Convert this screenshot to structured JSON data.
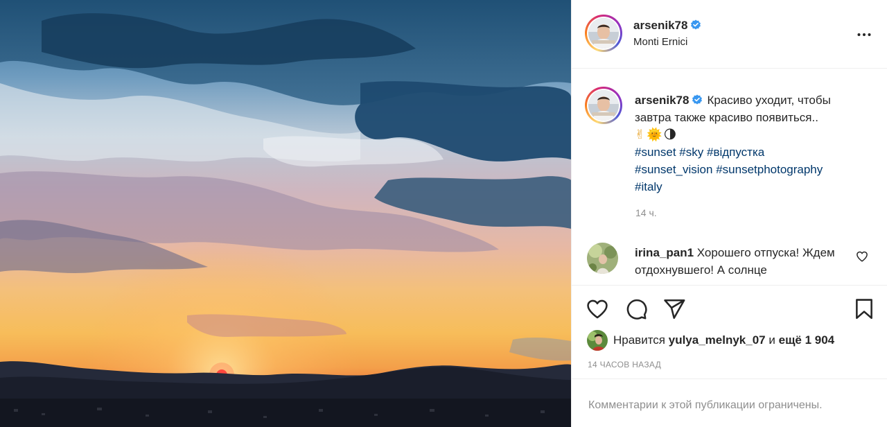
{
  "post": {
    "author": "arsenik78",
    "location": "Monti Ernici",
    "caption": "Красиво уходит, чтобы завтра также красиво появиться..",
    "emoji": [
      "✌",
      "🌞",
      "🌗"
    ],
    "hashtags": [
      "#sunset",
      "#sky",
      "#відпустка",
      "#sunset_vision",
      "#sunsetphotography",
      "#italy"
    ],
    "relative_time": "14 ч."
  },
  "comment": {
    "author": "irina_pan1",
    "text": "Хорошего отпуска! Ждем отдохнувшего! А солнце"
  },
  "likes": {
    "prefix": "Нравится",
    "user": "yulya_melnyk_07",
    "conjunction": "и",
    "others": "ещё 1 904"
  },
  "timestamp": "14 ЧАСОВ НАЗАД",
  "comments_restricted": "Комментарии к этой публикации ограничены.",
  "icons": {
    "verified": "verified-badge-icon",
    "more": "more-options-icon",
    "like": "heart-icon",
    "comment": "comment-bubble-icon",
    "share": "paper-plane-icon",
    "save": "bookmark-icon"
  },
  "colors": {
    "verified_blue": "#3897f0",
    "hashtag": "#00376b",
    "muted": "#8e8e8e",
    "text": "#262626"
  }
}
